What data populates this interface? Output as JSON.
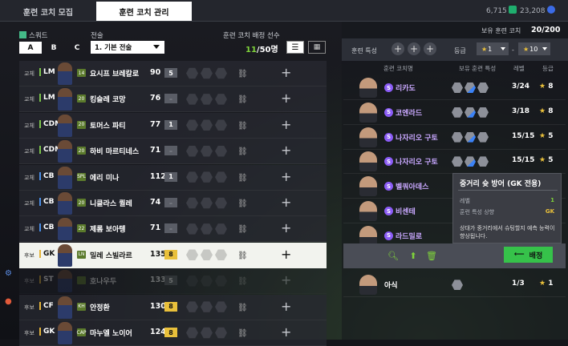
{
  "tabs": [
    {
      "label": "훈련 코치 모집"
    },
    {
      "label": "훈련 코치 관리"
    }
  ],
  "currency": {
    "amount1": "6,715",
    "amount2": "23,208",
    "color1": "#1fae6e",
    "color2": "#3b6be6"
  },
  "squad": {
    "label": "스쿼드",
    "buttons": [
      "A",
      "B",
      "C"
    ]
  },
  "tactics": {
    "label": "전술",
    "value": "1. 기본 전술"
  },
  "assigned": {
    "label": "훈련 코치 배정 선수",
    "current": "11",
    "total": "/50명"
  },
  "players": [
    {
      "status": "교체",
      "pos": "LM",
      "ovr": "90",
      "lvl": "5",
      "lvlStyle": "gray",
      "name": "요시프 브레칼로",
      "card": "14"
    },
    {
      "status": "교체",
      "pos": "LM",
      "ovr": "76",
      "lvl": "–",
      "lvlStyle": "dash",
      "name": "킹슬레 코망",
      "card": "20"
    },
    {
      "status": "교체",
      "pos": "CDM",
      "ovr": "77",
      "lvl": "1",
      "lvlStyle": "gray",
      "name": "토머스 파티",
      "card": "20"
    },
    {
      "status": "교체",
      "pos": "CDM",
      "ovr": "71",
      "lvl": "–",
      "lvlStyle": "dash",
      "name": "하비 마르티네스",
      "card": "20"
    },
    {
      "status": "교체",
      "pos": "CB",
      "ovr": "112",
      "lvl": "1",
      "lvlStyle": "gray",
      "name": "에리 미나",
      "card": "SPL"
    },
    {
      "status": "교체",
      "pos": "CB",
      "ovr": "74",
      "lvl": "–",
      "lvlStyle": "dash",
      "name": "니클라스 퀼레",
      "card": "20"
    },
    {
      "status": "교체",
      "pos": "CB",
      "ovr": "71",
      "lvl": "–",
      "lvlStyle": "dash",
      "name": "제롬 보아텡",
      "card": "22"
    },
    {
      "status": "후보",
      "pos": "GK",
      "ovr": "135",
      "lvl": "8",
      "lvlStyle": "yellow",
      "name": "밀레 스빌라르",
      "card": "LN"
    },
    {
      "status": "후보",
      "pos": "ST",
      "ovr": "133",
      "lvl": "5",
      "lvlStyle": "gray",
      "name": "호나우두",
      "card": ""
    },
    {
      "status": "후보",
      "pos": "CF",
      "ovr": "130",
      "lvl": "8",
      "lvlStyle": "yellow",
      "name": "안정환",
      "card": "KH"
    },
    {
      "status": "후보",
      "pos": "GK",
      "ovr": "124",
      "lvl": "8",
      "lvlStyle": "yellow",
      "name": "마누엘 노이어",
      "card": "CAP"
    }
  ],
  "coach_header": {
    "owned_label": "보유 훈련 코치",
    "owned_value": "20/200",
    "trait_label": "훈련 특성",
    "grade_label": "등급",
    "grade_from": "1",
    "grade_to": "10"
  },
  "coach_cols": {
    "name": "훈련 코치명",
    "traits": "보유 훈련 특성",
    "level": "레벨",
    "grade": "등급"
  },
  "coaches": [
    {
      "name": "리카도",
      "level": "3/24",
      "grade": "8"
    },
    {
      "name": "코엔라드",
      "level": "3/18",
      "grade": "8"
    },
    {
      "name": "나자리오 구토",
      "level": "15/15",
      "grade": "5"
    },
    {
      "name": "나자리오 구토",
      "level": "15/15",
      "grade": "5"
    },
    {
      "name": "벨쿼아데스",
      "level": "",
      "grade": ""
    },
    {
      "name": "비센테",
      "level": "",
      "grade": ""
    },
    {
      "name": "라드밀로",
      "level": "",
      "grade": ""
    },
    {
      "name": "",
      "level": "",
      "grade": ""
    },
    {
      "name": "아식",
      "level": "1/3",
      "grade": "1"
    }
  ],
  "assign_button": "배정",
  "tooltip": {
    "title": "중거리 슛 방어 (GK 전용)",
    "level_label": "레벨",
    "level_value": "1",
    "pos_label": "훈련 특성 상향",
    "pos_value": "GK",
    "desc": "상대가 중거리에서 슈팅할지 예측 능력이 향상됩니다."
  }
}
